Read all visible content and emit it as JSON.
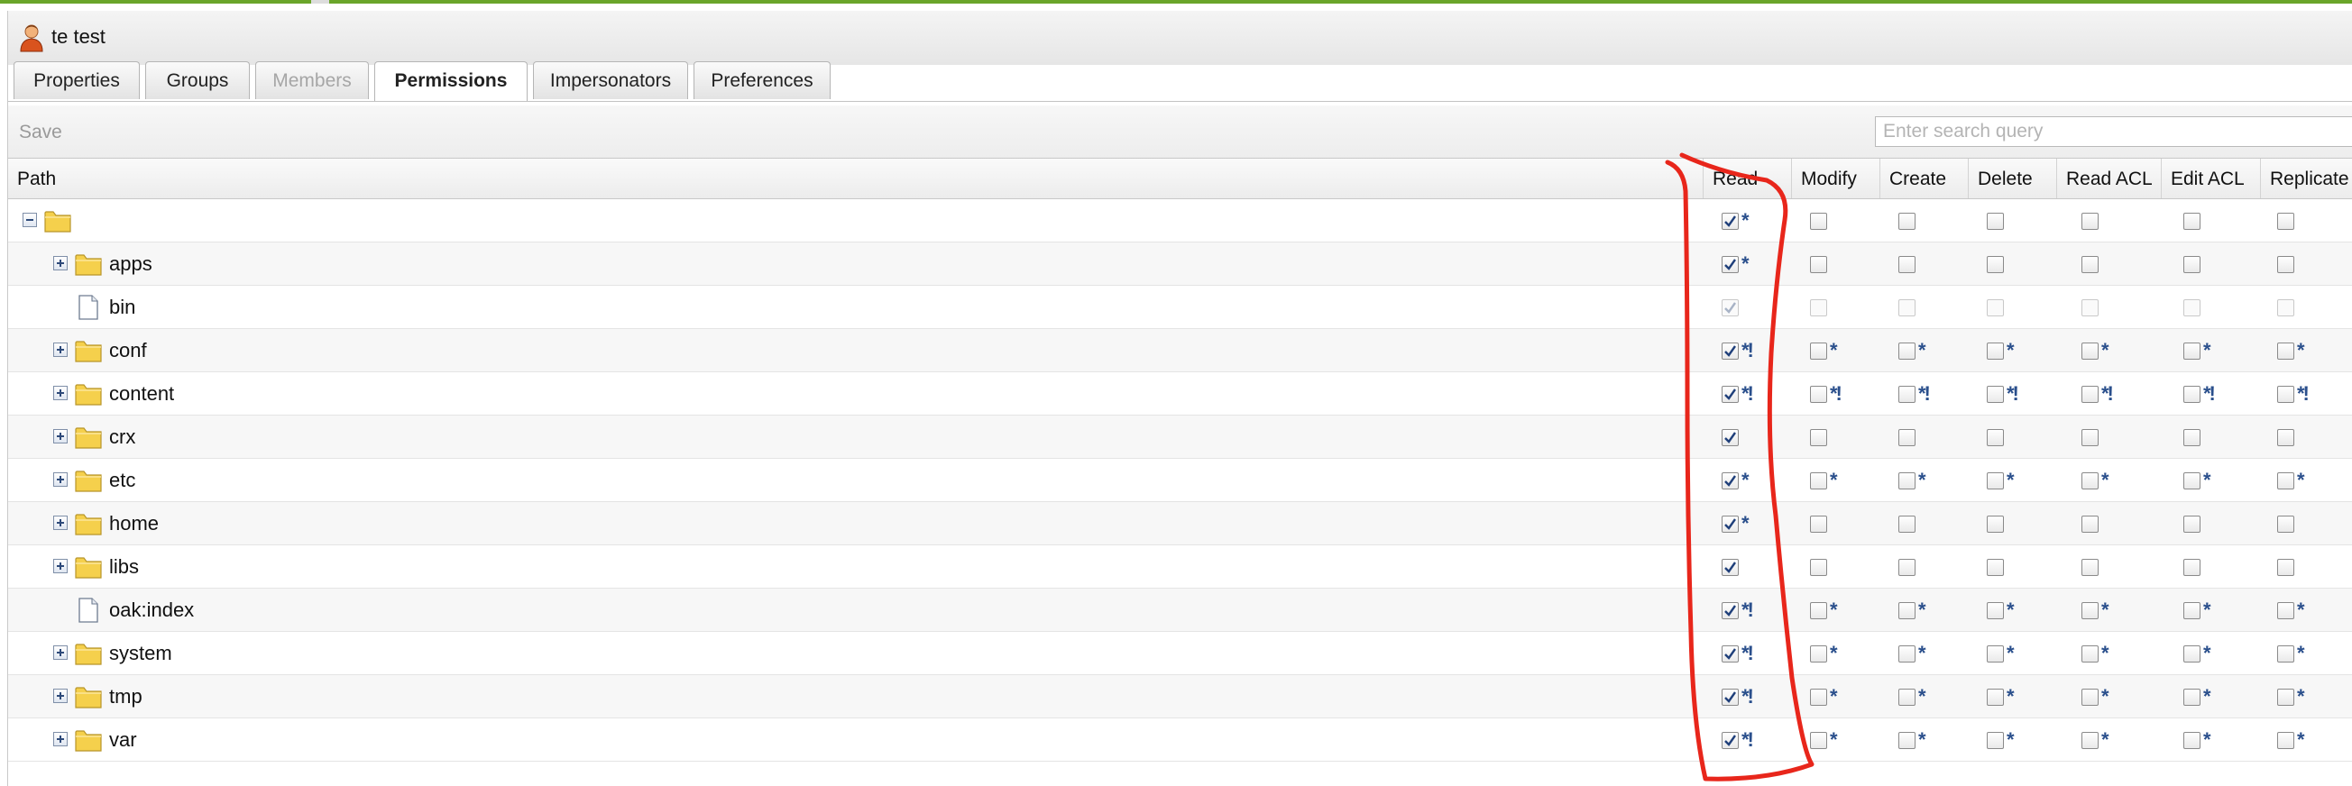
{
  "window": {
    "title": "te test",
    "icon": "user-icon"
  },
  "tabs": [
    {
      "label": "Properties",
      "state": "normal"
    },
    {
      "label": "Groups",
      "state": "normal"
    },
    {
      "label": "Members",
      "state": "disabled"
    },
    {
      "label": "Permissions",
      "state": "active"
    },
    {
      "label": "Impersonators",
      "state": "normal"
    },
    {
      "label": "Preferences",
      "state": "normal"
    }
  ],
  "toolbar": {
    "save_label": "Save",
    "search_placeholder": "Enter search query"
  },
  "columns": {
    "path": "Path",
    "permissions": [
      "Read",
      "Modify",
      "Create",
      "Delete",
      "Read ACL",
      "Edit ACL",
      "Replicate"
    ]
  },
  "rows": [
    {
      "path": "",
      "type": "folder",
      "expander": "minus",
      "perms": [
        {
          "checked": true,
          "mark": "*"
        },
        {
          "checked": false,
          "mark": ""
        },
        {
          "checked": false,
          "mark": ""
        },
        {
          "checked": false,
          "mark": ""
        },
        {
          "checked": false,
          "mark": ""
        },
        {
          "checked": false,
          "mark": ""
        },
        {
          "checked": false,
          "mark": ""
        }
      ]
    },
    {
      "path": "apps",
      "type": "folder",
      "expander": "plus",
      "perms": [
        {
          "checked": true,
          "mark": "*"
        },
        {
          "checked": false,
          "mark": ""
        },
        {
          "checked": false,
          "mark": ""
        },
        {
          "checked": false,
          "mark": ""
        },
        {
          "checked": false,
          "mark": ""
        },
        {
          "checked": false,
          "mark": ""
        },
        {
          "checked": false,
          "mark": ""
        }
      ]
    },
    {
      "path": "bin",
      "type": "file",
      "expander": "none",
      "disabled": true,
      "perms": [
        {
          "checked": true,
          "mark": ""
        },
        {
          "checked": false,
          "mark": ""
        },
        {
          "checked": false,
          "mark": ""
        },
        {
          "checked": false,
          "mark": ""
        },
        {
          "checked": false,
          "mark": ""
        },
        {
          "checked": false,
          "mark": ""
        },
        {
          "checked": false,
          "mark": ""
        }
      ]
    },
    {
      "path": "conf",
      "type": "folder",
      "expander": "plus",
      "perms": [
        {
          "checked": true,
          "mark": "*!"
        },
        {
          "checked": false,
          "mark": "*"
        },
        {
          "checked": false,
          "mark": "*"
        },
        {
          "checked": false,
          "mark": "*"
        },
        {
          "checked": false,
          "mark": "*"
        },
        {
          "checked": false,
          "mark": "*"
        },
        {
          "checked": false,
          "mark": "*"
        }
      ]
    },
    {
      "path": "content",
      "type": "folder",
      "expander": "plus",
      "perms": [
        {
          "checked": true,
          "mark": "*!"
        },
        {
          "checked": false,
          "mark": "*!"
        },
        {
          "checked": false,
          "mark": "*!"
        },
        {
          "checked": false,
          "mark": "*!"
        },
        {
          "checked": false,
          "mark": "*!"
        },
        {
          "checked": false,
          "mark": "*!"
        },
        {
          "checked": false,
          "mark": "*!"
        }
      ]
    },
    {
      "path": "crx",
      "type": "folder",
      "expander": "plus",
      "perms": [
        {
          "checked": true,
          "mark": ""
        },
        {
          "checked": false,
          "mark": ""
        },
        {
          "checked": false,
          "mark": ""
        },
        {
          "checked": false,
          "mark": ""
        },
        {
          "checked": false,
          "mark": ""
        },
        {
          "checked": false,
          "mark": ""
        },
        {
          "checked": false,
          "mark": ""
        }
      ]
    },
    {
      "path": "etc",
      "type": "folder",
      "expander": "plus",
      "perms": [
        {
          "checked": true,
          "mark": "*"
        },
        {
          "checked": false,
          "mark": "*"
        },
        {
          "checked": false,
          "mark": "*"
        },
        {
          "checked": false,
          "mark": "*"
        },
        {
          "checked": false,
          "mark": "*"
        },
        {
          "checked": false,
          "mark": "*"
        },
        {
          "checked": false,
          "mark": "*"
        }
      ]
    },
    {
      "path": "home",
      "type": "folder",
      "expander": "plus",
      "perms": [
        {
          "checked": true,
          "mark": "*"
        },
        {
          "checked": false,
          "mark": ""
        },
        {
          "checked": false,
          "mark": ""
        },
        {
          "checked": false,
          "mark": ""
        },
        {
          "checked": false,
          "mark": ""
        },
        {
          "checked": false,
          "mark": ""
        },
        {
          "checked": false,
          "mark": ""
        }
      ]
    },
    {
      "path": "libs",
      "type": "folder",
      "expander": "plus",
      "perms": [
        {
          "checked": true,
          "mark": ""
        },
        {
          "checked": false,
          "mark": ""
        },
        {
          "checked": false,
          "mark": ""
        },
        {
          "checked": false,
          "mark": ""
        },
        {
          "checked": false,
          "mark": ""
        },
        {
          "checked": false,
          "mark": ""
        },
        {
          "checked": false,
          "mark": ""
        }
      ]
    },
    {
      "path": "oak:index",
      "type": "file",
      "expander": "none",
      "perms": [
        {
          "checked": true,
          "mark": "*!"
        },
        {
          "checked": false,
          "mark": "*"
        },
        {
          "checked": false,
          "mark": "*"
        },
        {
          "checked": false,
          "mark": "*"
        },
        {
          "checked": false,
          "mark": "*"
        },
        {
          "checked": false,
          "mark": "*"
        },
        {
          "checked": false,
          "mark": "*"
        }
      ]
    },
    {
      "path": "system",
      "type": "folder",
      "expander": "plus",
      "perms": [
        {
          "checked": true,
          "mark": "*!"
        },
        {
          "checked": false,
          "mark": "*"
        },
        {
          "checked": false,
          "mark": "*"
        },
        {
          "checked": false,
          "mark": "*"
        },
        {
          "checked": false,
          "mark": "*"
        },
        {
          "checked": false,
          "mark": "*"
        },
        {
          "checked": false,
          "mark": "*"
        }
      ]
    },
    {
      "path": "tmp",
      "type": "folder",
      "expander": "plus",
      "perms": [
        {
          "checked": true,
          "mark": "*!"
        },
        {
          "checked": false,
          "mark": "*"
        },
        {
          "checked": false,
          "mark": "*"
        },
        {
          "checked": false,
          "mark": "*"
        },
        {
          "checked": false,
          "mark": "*"
        },
        {
          "checked": false,
          "mark": "*"
        },
        {
          "checked": false,
          "mark": "*"
        }
      ]
    },
    {
      "path": "var",
      "type": "folder",
      "expander": "plus",
      "perms": [
        {
          "checked": true,
          "mark": "*!"
        },
        {
          "checked": false,
          "mark": "*"
        },
        {
          "checked": false,
          "mark": "*"
        },
        {
          "checked": false,
          "mark": "*"
        },
        {
          "checked": false,
          "mark": "*"
        },
        {
          "checked": false,
          "mark": "*"
        },
        {
          "checked": false,
          "mark": "*"
        }
      ]
    }
  ],
  "colors": {
    "accent_bar": "#6aa52a",
    "check_mark": "#1f3f7a",
    "flag": "#2a4f8c",
    "annotation": "#e8261b"
  }
}
